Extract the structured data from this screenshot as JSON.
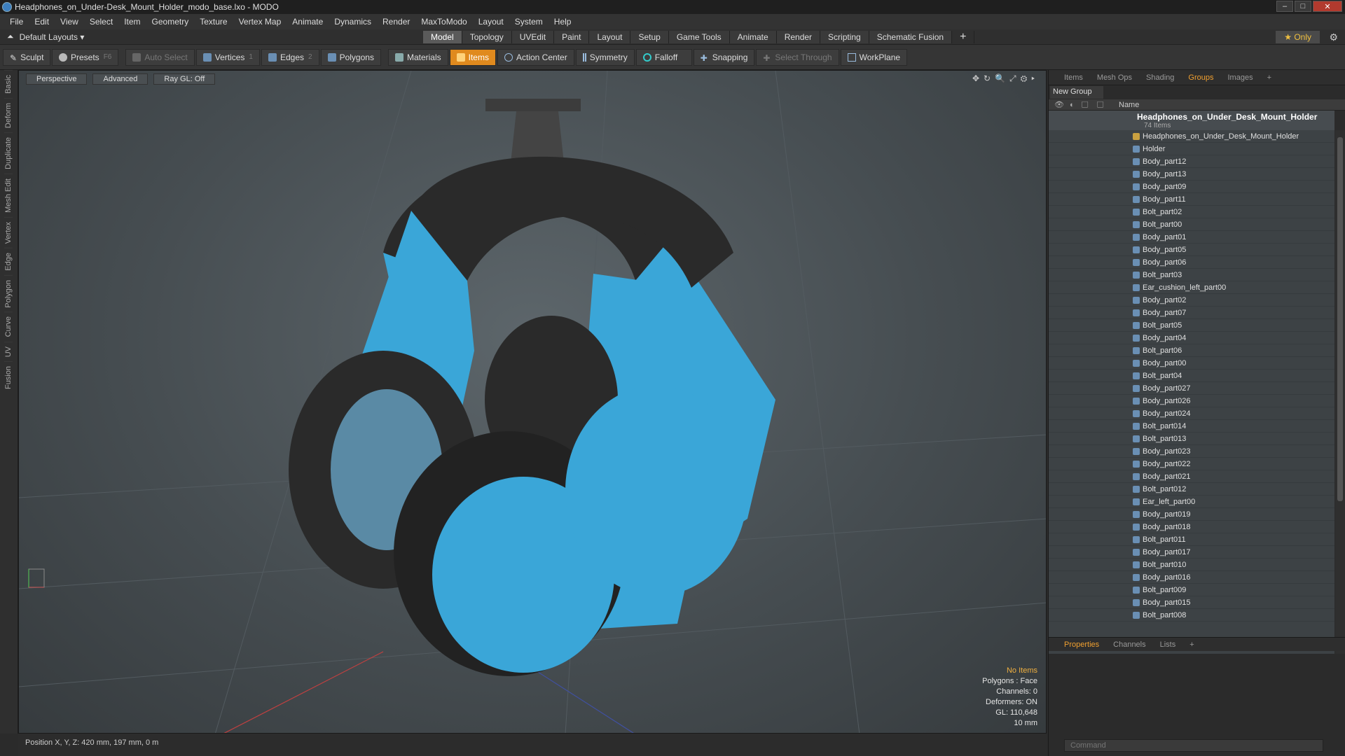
{
  "window": {
    "title": "Headphones_on_Under-Desk_Mount_Holder_modo_base.lxo - MODO"
  },
  "menu": [
    "File",
    "Edit",
    "View",
    "Select",
    "Item",
    "Geometry",
    "Texture",
    "Vertex Map",
    "Animate",
    "Dynamics",
    "Render",
    "MaxToModo",
    "Layout",
    "System",
    "Help"
  ],
  "layout": {
    "selector": "Default Layouts ▾",
    "only": "★  Only"
  },
  "tabs": [
    {
      "label": "Model",
      "active": true
    },
    {
      "label": "Topology"
    },
    {
      "label": "UVEdit"
    },
    {
      "label": "Paint"
    },
    {
      "label": "Layout"
    },
    {
      "label": "Setup"
    },
    {
      "label": "Game Tools"
    },
    {
      "label": "Animate"
    },
    {
      "label": "Render"
    },
    {
      "label": "Scripting"
    },
    {
      "label": "Schematic Fusion"
    }
  ],
  "toolbar": {
    "sculpt": "Sculpt",
    "presets": "Presets",
    "presets_key": "F6",
    "auto_select": "Auto Select",
    "vertices": "Vertices",
    "vertices_key": "1",
    "edges": "Edges",
    "edges_key": "2",
    "polygons": "Polygons",
    "materials": "Materials",
    "items": "Items",
    "action_center": "Action Center",
    "symmetry": "Symmetry",
    "falloff": "Falloff",
    "snapping": "Snapping",
    "select_through": "Select Through",
    "workplane": "WorkPlane"
  },
  "side_tabs": [
    "Basic",
    "Deform",
    "Duplicate",
    "Mesh Edit",
    "Vertex",
    "Edge",
    "Polygon",
    "Curve",
    "UV",
    "Fusion"
  ],
  "viewport": {
    "view": "Perspective",
    "shading": "Advanced",
    "raygl": "Ray GL: Off",
    "stats": {
      "items": "No Items",
      "polygons": "Polygons : Face",
      "channels": "Channels: 0",
      "deformers": "Deformers: ON",
      "gl": "GL: 110,648",
      "unit": "10 mm"
    }
  },
  "status": {
    "position": "Position X, Y, Z:  420 mm, 197 mm, 0 m"
  },
  "right": {
    "tabs": [
      {
        "label": "Items"
      },
      {
        "label": "Mesh Ops"
      },
      {
        "label": "Shading"
      },
      {
        "label": "Groups",
        "active": true
      },
      {
        "label": "Images"
      }
    ],
    "new_group": "New Group",
    "name_header": "Name",
    "group_title": "Headphones_on_Under_Desk_Mount_Holder",
    "group_count": "74 Items",
    "items": [
      "Headphones_on_Under_Desk_Mount_Holder",
      "Holder",
      "Body_part12",
      "Body_part13",
      "Body_part09",
      "Body_part11",
      "Bolt_part02",
      "Bolt_part00",
      "Body_part01",
      "Body_part05",
      "Body_part06",
      "Bolt_part03",
      "Ear_cushion_left_part00",
      "Body_part02",
      "Body_part07",
      "Bolt_part05",
      "Body_part04",
      "Bolt_part06",
      "Body_part00",
      "Bolt_part04",
      "Body_part027",
      "Body_part026",
      "Body_part024",
      "Bolt_part014",
      "Bolt_part013",
      "Body_part023",
      "Body_part022",
      "Body_part021",
      "Bolt_part012",
      "Ear_left_part00",
      "Body_part019",
      "Body_part018",
      "Bolt_part011",
      "Body_part017",
      "Bolt_part010",
      "Body_part016",
      "Bolt_part009",
      "Body_part015",
      "Bolt_part008"
    ],
    "bottom_tabs": [
      {
        "label": "Properties",
        "active": true
      },
      {
        "label": "Channels"
      },
      {
        "label": "Lists"
      }
    ],
    "command_placeholder": "Command"
  },
  "colors": {
    "accent": "#e08a1e",
    "headphone_blue": "#3aa6d8",
    "cushion": "#2a2a2a"
  }
}
